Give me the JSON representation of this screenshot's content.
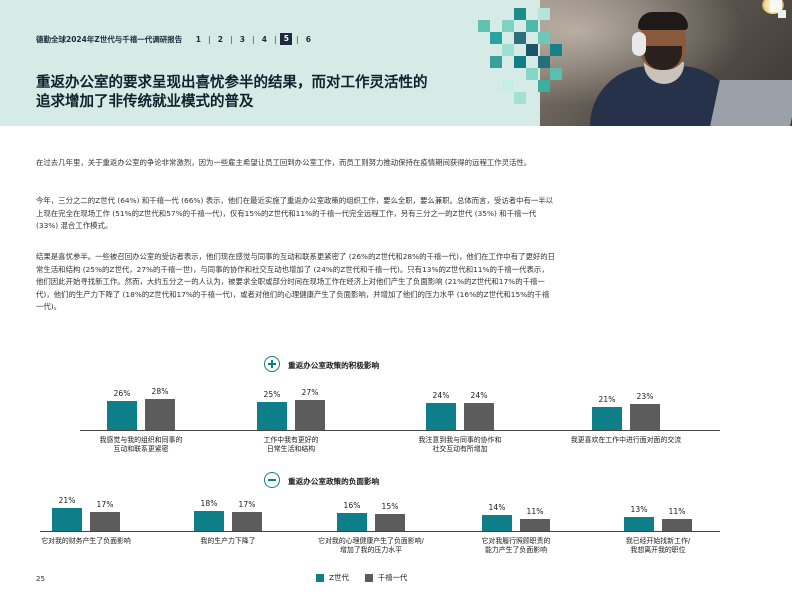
{
  "header": {
    "report_title": "德勤全球2024年Z世代与千禧一代调研报告",
    "nav": [
      "1",
      "2",
      "3",
      "4",
      "5",
      "6"
    ],
    "active_page": "5",
    "headline_line1": "重返办公室的要求呈现出喜忧参半的结果，而对工作灵活性的",
    "headline_line2": "追求增加了非传统就业模式的普及"
  },
  "body": {
    "p1": "在过去几年里，关于重返办公室的争论非常激烈，因为一些雇主希望让员工回到办公室工作，而员工则努力推动保持在疫情期间获得的远程工作灵活性。",
    "p2": "今年，三分之二的Z世代 (64%) 和千禧一代 (66%) 表示，他们在最近实施了重返办公室政策的组织工作，要么全职，要么兼职。总体而言，受访者中有一半以上现在完全在现场工作 (51%的Z世代和57%的千禧一代)，仅有15%的Z世代和11%的千禧一代完全远程工作，另有三分之一的Z世代 (35%) 和千禧一代 (33%) 混合工作模式。",
    "p3": "结果是喜忧参半。一些被召回办公室的受访者表示，他们现在感觉与同事的互动和联系更紧密了 (26%的Z世代和28%的千禧一代)，他们在工作中有了更好的日常生活和结构 (25%的Z世代，27%的千禧一世)，与同事的协作和社交互动也增加了 (24%的Z世代和千禧一代)。只有13%的Z世代和11%的千禧一代表示，他们因此开始寻找新工作。然而，大约五分之一的人认为，被要求全职或部分时间在现场工作在经济上对他们产生了负面影响 (21%的Z世代和17%的千禧一代)，他们的生产力下降了 (18%的Z世代和17%的千禧一代)，或者对他们的心理健康产生了负面影响，并增加了他们的压力水平 (16%的Z世代和15%的千禧一代)。"
  },
  "colors": {
    "genz": "#0e7f88",
    "millennial": "#5c5c5c",
    "hero_bg": "#d6ebe6"
  },
  "chart_data": [
    {
      "type": "bar",
      "title": "重返办公室政策的积极影响",
      "icon": "plus-circle-icon",
      "categories": [
        "我感觉与我的组织和同事的互动和联系更紧密",
        "工作中我有更好的日常生活和结构",
        "我注意到我与同事的协作和社交互动有所增加",
        "我更喜欢在工作中进行面对面的交流"
      ],
      "category_lines": [
        [
          "我感觉与我的组织和同事的",
          "互动和联系更紧密"
        ],
        [
          "工作中我有更好的",
          "日常生活和结构"
        ],
        [
          "我注意到我与同事的协作和",
          "社交互动有所增加"
        ],
        [
          "我更喜欢在工作中进行面对面的交流"
        ]
      ],
      "series": [
        {
          "name": "Z世代",
          "values": [
            26,
            25,
            24,
            21
          ],
          "labels": [
            "26%",
            "25%",
            "24%",
            "21%"
          ]
        },
        {
          "name": "千禧一代",
          "values": [
            28,
            27,
            24,
            23
          ],
          "labels": [
            "28%",
            "27%",
            "24%",
            "23%"
          ]
        }
      ]
    },
    {
      "type": "bar",
      "title": "重返办公室政策的负面影响",
      "icon": "minus-circle-icon",
      "categories": [
        "它对我的财务产生了负面影响",
        "我的生产力下降了",
        "它对我的心理健康产生了负面影响/增加了我的压力水平",
        "它对我履行照顾职责的能力产生了负面影响",
        "我已经开始找新工作/我想离开我的职位"
      ],
      "category_lines": [
        [
          "它对我的财务产生了负面影响"
        ],
        [
          "我的生产力下降了"
        ],
        [
          "它对我的心理健康产生了负面影响/",
          "增加了我的压力水平"
        ],
        [
          "它对我履行照顾职责的",
          "能力产生了负面影响"
        ],
        [
          "我已经开始找新工作/",
          "我想离开我的职位"
        ]
      ],
      "series": [
        {
          "name": "Z世代",
          "values": [
            21,
            18,
            16,
            14,
            13
          ],
          "labels": [
            "21%",
            "18%",
            "16%",
            "14%",
            "13%"
          ]
        },
        {
          "name": "千禧一代",
          "values": [
            17,
            17,
            15,
            11,
            11
          ],
          "labels": [
            "17%",
            "17%",
            "15%",
            "11%",
            "11%"
          ]
        }
      ]
    }
  ],
  "legend": {
    "genz": "Z世代",
    "millennial": "千禧一代"
  },
  "page_number": "25"
}
